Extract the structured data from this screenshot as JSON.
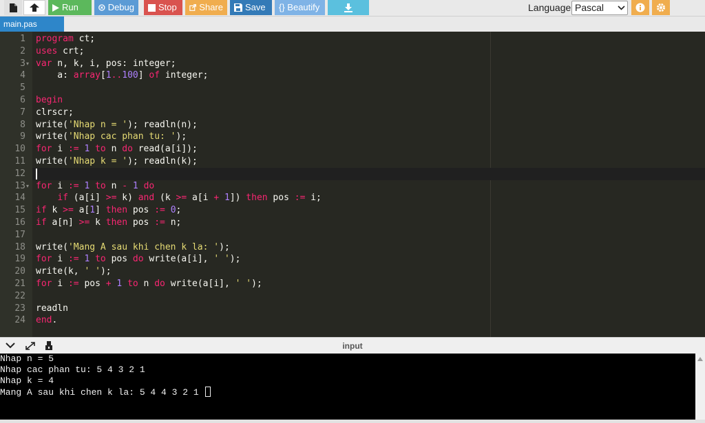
{
  "toolbar": {
    "run": "Run",
    "debug": "Debug",
    "stop": "Stop",
    "share": "Share",
    "save": "Save",
    "beautify": "{} Beautify",
    "language_label": "Language",
    "language_selected": "Pascal",
    "colors": {
      "run": "#5cb85c",
      "debug": "#5b9bd5",
      "stop": "#d9534f",
      "share": "#f0ad4e",
      "save": "#337ab7",
      "beautify": "#7fb3e6",
      "download": "#5bc0de",
      "info": "#f0ad4e",
      "settings": "#f0ad4e"
    },
    "icons": [
      "file-icon",
      "upload-icon",
      "play-icon",
      "bug-icon",
      "stop-icon",
      "share-icon",
      "save-icon",
      "download-icon",
      "info-icon",
      "gear-icon"
    ]
  },
  "tabs": [
    {
      "label": "main.pas",
      "active": true
    }
  ],
  "editor": {
    "line_numbers": [
      "1",
      "2",
      "3",
      "4",
      "5",
      "6",
      "7",
      "8",
      "9",
      "10",
      "11",
      "12",
      "13",
      "14",
      "15",
      "16",
      "17",
      "18",
      "19",
      "20",
      "21",
      "22",
      "23",
      "24"
    ],
    "code": [
      "program ct;",
      "uses crt;",
      "var n, k, i, pos: integer;",
      "    a: array[1..100] of integer;",
      "",
      "begin",
      "clrscr;",
      "write('Nhap n = '); readln(n);",
      "write('Nhap cac phan tu: ');",
      "for i := 1 to n do read(a[i]);",
      "write('Nhap k = '); readln(k);",
      "",
      "for i := 1 to n - 1 do",
      "    if (a[i] >= k) and (k >= a[i + 1]) then pos := i;",
      "if k >= a[1] then pos := 0;",
      "if a[n] >= k then pos := n;",
      "",
      "write('Mang A sau khi chen k la: ');",
      "for i := 1 to pos do write(a[i], ' ');",
      "write(k, ' ');",
      "for i := pos + 1 to n do write(a[i], ' ');",
      "",
      "readln",
      "end."
    ],
    "active_line": 12,
    "fold_lines": [
      3,
      13
    ]
  },
  "io": {
    "title": "input",
    "icons": [
      "chevron-down-icon",
      "expand-icon",
      "copy-icon"
    ],
    "output": [
      "Nhap n = 5",
      "Nhap cac phan tu: 5 4 3 2 1",
      "Nhap k = 4",
      "Mang A sau khi chen k la: 5 4 4 3 2 1 "
    ]
  }
}
